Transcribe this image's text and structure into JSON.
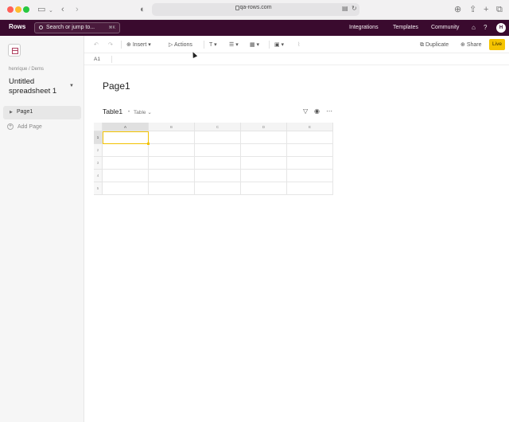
{
  "browser": {
    "url": "qa-rows.com",
    "icons": [
      "sidebar-toggle-icon",
      "back-icon",
      "forward-icon",
      "shield-icon",
      "translate-icon",
      "reload-icon",
      "download-icon",
      "share-icon",
      "new-tab-icon",
      "tabs-icon"
    ]
  },
  "header": {
    "logo": "Rows",
    "search_placeholder": "Search or jump to...",
    "search_shortcut": "⌘K",
    "nav": [
      "Integrations",
      "Templates",
      "Community"
    ],
    "avatar_initial": "H"
  },
  "sidebar": {
    "breadcrumb": "henrique / Dems",
    "doc_title": "Untitled spreadsheet 1",
    "pages": [
      {
        "label": "Page1"
      }
    ],
    "add_page": "Add Page"
  },
  "toolbar": {
    "insert": "Insert",
    "actions": "Actions",
    "duplicate": "Duplicate",
    "share": "Share",
    "live": "Live"
  },
  "formula_bar": {
    "cell_ref": "A1"
  },
  "page": {
    "title": "Page1",
    "table_title": "Table1",
    "table_type": "Table"
  },
  "grid": {
    "columns": [
      "A",
      "B",
      "C",
      "D",
      "E"
    ],
    "rows": [
      "1",
      "2",
      "3",
      "4",
      "5"
    ],
    "selected_cell": "A1"
  },
  "colors": {
    "brand": "#3a0a2e",
    "live": "#f5c400",
    "selection": "#f2c200"
  }
}
